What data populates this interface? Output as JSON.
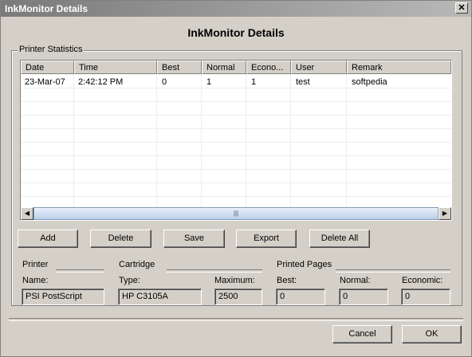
{
  "window": {
    "title": "InkMonitor Details",
    "close_glyph": "✕"
  },
  "heading": "InkMonitor Details",
  "group": {
    "label": "Printer Statistics"
  },
  "table": {
    "columns": [
      "Date",
      "Time",
      "Best",
      "Normal",
      "Econo...",
      "User",
      "Remark"
    ],
    "rows": [
      [
        "23-Mar-07",
        "2:42:12 PM",
        "0",
        "1",
        "1",
        "test",
        "softpedia"
      ]
    ]
  },
  "scrollbar": {
    "left_glyph": "◀",
    "right_glyph": "▶",
    "grip_glyph": "|||"
  },
  "actions": [
    "Add",
    "Delete",
    "Save",
    "Export",
    "Delete All"
  ],
  "printer": {
    "section": "Printer",
    "name_label": "Name:",
    "name_value": "PSI PostScript"
  },
  "cartridge": {
    "section": "Cartridge",
    "type_label": "Type:",
    "type_value": "HP C3105A",
    "max_label": "Maximum:",
    "max_value": "2500"
  },
  "pages": {
    "section": "Printed Pages",
    "best_label": "Best:",
    "best_value": "0",
    "normal_label": "Normal:",
    "normal_value": "0",
    "economic_label": "Economic:",
    "economic_value": "0"
  },
  "footer": {
    "cancel": "Cancel",
    "ok": "OK"
  }
}
